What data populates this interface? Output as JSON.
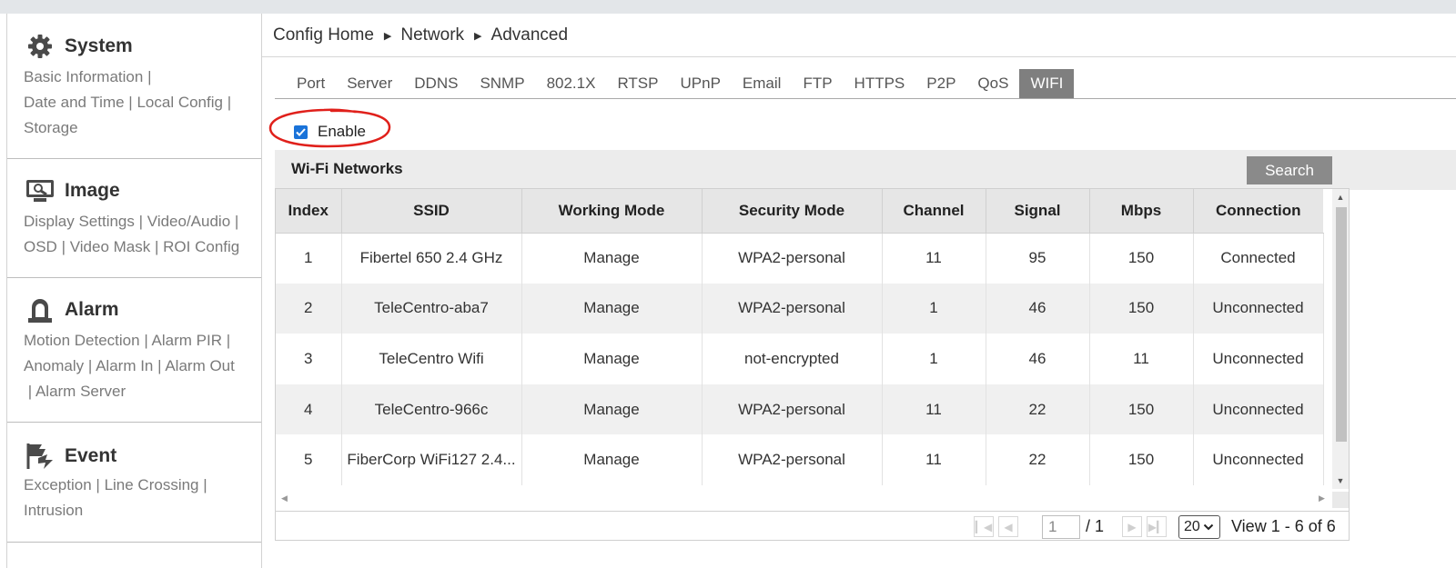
{
  "sidebar": {
    "sections": [
      {
        "title": "System",
        "icon": "gear-icon",
        "links": [
          "Basic Information",
          "Date and Time",
          "Local Config",
          "Storage"
        ]
      },
      {
        "title": "Image",
        "icon": "image-settings-icon",
        "links": [
          "Display Settings",
          "Video/Audio",
          "OSD",
          "Video Mask",
          "ROI Config"
        ]
      },
      {
        "title": "Alarm",
        "icon": "alarm-light-icon",
        "links": [
          "Motion Detection",
          "Alarm PIR",
          "Anomaly",
          "Alarm In",
          "Alarm Out",
          "Alarm Server"
        ]
      },
      {
        "title": "Event",
        "icon": "event-icon",
        "links": [
          "Exception",
          "Line Crossing",
          "Intrusion"
        ]
      }
    ],
    "separator": "|"
  },
  "breadcrumb": [
    "Config Home",
    "Network",
    "Advanced"
  ],
  "tabs": [
    "Port",
    "Server",
    "DDNS",
    "SNMP",
    "802.1X",
    "RTSP",
    "UPnP",
    "Email",
    "FTP",
    "HTTPS",
    "P2P",
    "QoS",
    "WIFI"
  ],
  "active_tab": "WIFI",
  "enable": {
    "label": "Enable",
    "checked": true
  },
  "panel": {
    "title": "Wi-Fi Networks",
    "search_label": "Search"
  },
  "table": {
    "columns": [
      "Index",
      "SSID",
      "Working Mode",
      "Security Mode",
      "Channel",
      "Signal",
      "Mbps",
      "Connection"
    ],
    "rows": [
      [
        "1",
        "Fibertel 650 2.4 GHz",
        "Manage",
        "WPA2-personal",
        "11",
        "95",
        "150",
        "Connected"
      ],
      [
        "2",
        "TeleCentro-aba7",
        "Manage",
        "WPA2-personal",
        "1",
        "46",
        "150",
        "Unconnected"
      ],
      [
        "3",
        "TeleCentro Wifi",
        "Manage",
        "not-encrypted",
        "1",
        "46",
        "11",
        "Unconnected"
      ],
      [
        "4",
        "TeleCentro-966c",
        "Manage",
        "WPA2-personal",
        "11",
        "22",
        "150",
        "Unconnected"
      ],
      [
        "5",
        "FiberCorp WiFi127 2.4...",
        "Manage",
        "WPA2-personal",
        "11",
        "22",
        "150",
        "Unconnected"
      ]
    ]
  },
  "pager": {
    "page": "1",
    "total": "/ 1",
    "page_size": "20",
    "view_info": "View 1 - 6 of 6"
  },
  "colors": {
    "active_tab_bg": "#7f7f7f",
    "checkbox": "#1a73d9",
    "annotation_circle": "#e0201b"
  }
}
